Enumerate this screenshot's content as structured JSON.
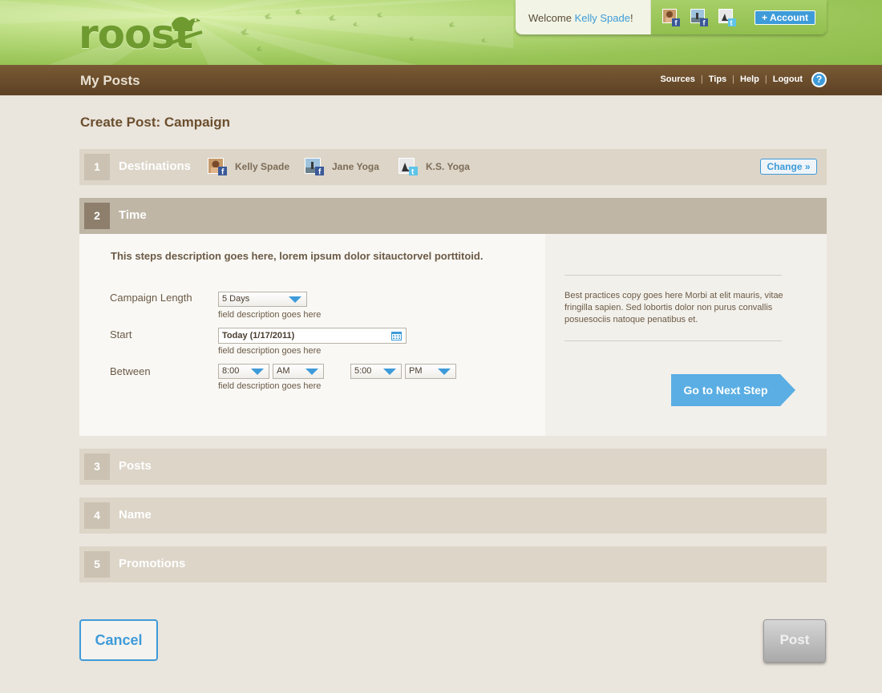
{
  "header": {
    "logo_text": "roost",
    "welcome_prefix": "Welcome ",
    "user_name": "Kelly Spade",
    "welcome_suffix": "!",
    "account_button": "+ Account"
  },
  "nav": {
    "page_title": "My Posts",
    "links": [
      "Sources",
      "Tips",
      "Help",
      "Logout"
    ],
    "help_icon": "?"
  },
  "main": {
    "title": "Create Post: Campaign",
    "steps": [
      {
        "number": "1",
        "label": "Destinations"
      },
      {
        "number": "2",
        "label": "Time"
      },
      {
        "number": "3",
        "label": "Posts"
      },
      {
        "number": "4",
        "label": "Name"
      },
      {
        "number": "5",
        "label": "Promotions"
      }
    ],
    "destinations": [
      {
        "name": "Kelly Spade",
        "network": "facebook"
      },
      {
        "name": "Jane Yoga",
        "network": "facebook"
      },
      {
        "name": "K.S. Yoga",
        "network": "twitter"
      }
    ],
    "change_button": "Change »",
    "time_step": {
      "description": "This steps description goes here, lorem ipsum dolor sitauctorvel porttitoid.",
      "campaign_length_label": "Campaign Length",
      "campaign_length_value": "5 Days",
      "start_label": "Start",
      "start_value": "Today (1/17/2011)",
      "between_label": "Between",
      "from_time": "8:00",
      "from_ampm": "AM",
      "to_time": "5:00",
      "to_ampm": "PM",
      "field_description": "field description goes here",
      "best_practices": "Best practices copy goes here Morbi at elit mauris, vitae fringilla sapien. Sed lobortis dolor non purus convallis posuesociis natoque penatibus et.",
      "next_button": "Go to Next Step"
    }
  },
  "footer": {
    "cancel_button": "Cancel",
    "post_button": "Post"
  },
  "colors": {
    "accent_blue": "#3e9bd9",
    "header_green": "#98c456",
    "nav_brown": "#6b4b2a",
    "step_bg": "#dcd5c8",
    "step_active_bg": "#bfb6a6"
  }
}
